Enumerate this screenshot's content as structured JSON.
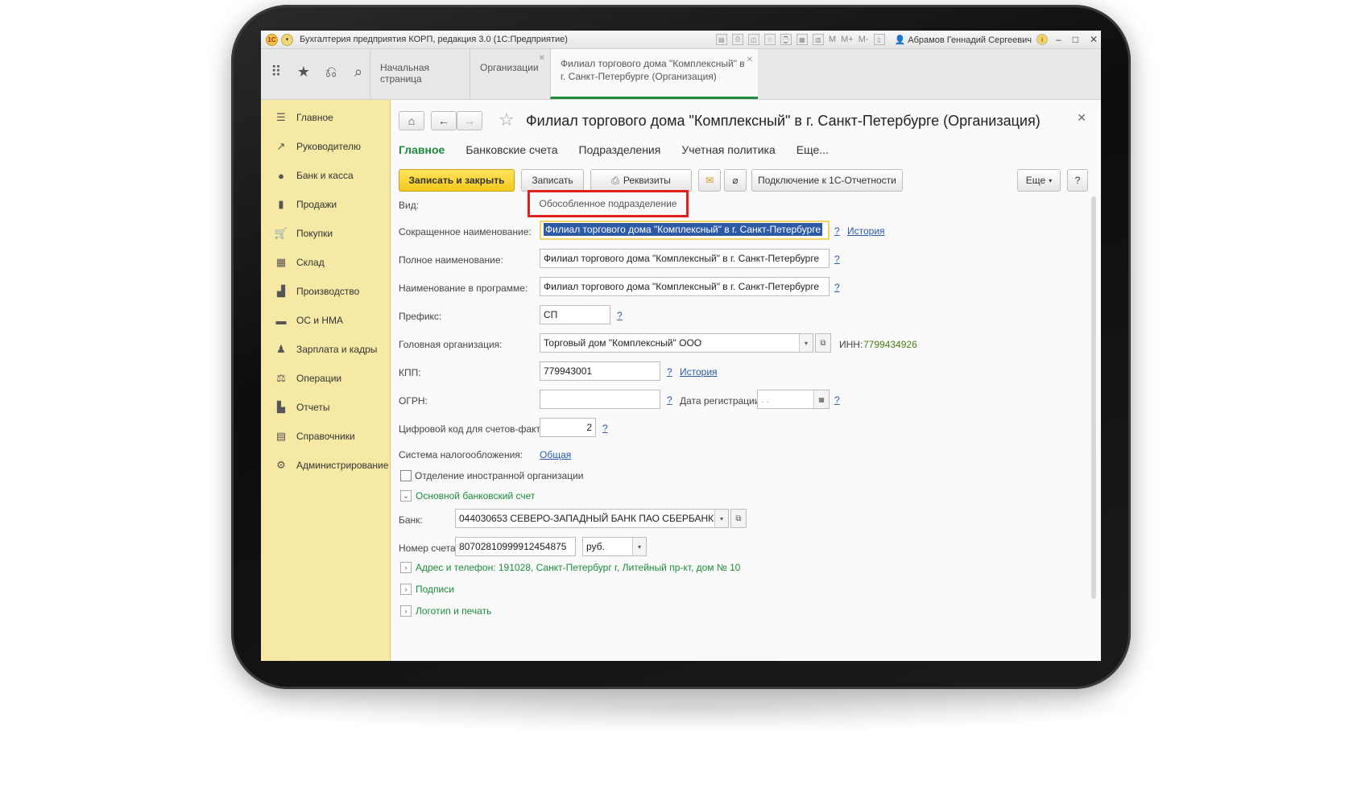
{
  "window": {
    "title": "Бухгалтерия предприятия КОРП, редакция 3.0 (1С:Предприятие)",
    "user": "Абрамов Геннадий Сергеевич",
    "tool_m": "M",
    "tool_mplus": "M+",
    "tool_mminus": "M-"
  },
  "tabs": [
    {
      "label": "Начальная страница"
    },
    {
      "label": "Организации"
    },
    {
      "label": "Филиал торгового дома \"Комплексный\" в г. Санкт-Петербурге (Организация)"
    }
  ],
  "sidebar": {
    "items": [
      {
        "label": "Главное",
        "icon": "menu-icon"
      },
      {
        "label": "Руководителю",
        "icon": "chart-line-icon"
      },
      {
        "label": "Банк и касса",
        "icon": "bank-icon"
      },
      {
        "label": "Продажи",
        "icon": "bag-icon"
      },
      {
        "label": "Покупки",
        "icon": "cart-icon"
      },
      {
        "label": "Склад",
        "icon": "warehouse-icon"
      },
      {
        "label": "Производство",
        "icon": "factory-icon"
      },
      {
        "label": "ОС и НМА",
        "icon": "truck-icon"
      },
      {
        "label": "Зарплата и кадры",
        "icon": "person-icon"
      },
      {
        "label": "Операции",
        "icon": "operations-icon"
      },
      {
        "label": "Отчеты",
        "icon": "bar-chart-icon"
      },
      {
        "label": "Справочники",
        "icon": "book-icon"
      },
      {
        "label": "Администрирование",
        "icon": "gear-icon"
      }
    ]
  },
  "form": {
    "title": "Филиал торгового дома \"Комплексный\" в г. Санкт-Петербурге (Организация)",
    "subtabs": [
      "Главное",
      "Банковские счета",
      "Подразделения",
      "Учетная политика",
      "Еще..."
    ],
    "buttons": {
      "save_close": "Записать и закрыть",
      "save": "Записать",
      "requisites": "Реквизиты",
      "connect": "Подключение к 1С-Отчетности",
      "more": "Еще",
      "help": "?"
    },
    "fields": {
      "vid_label": "Вид:",
      "vid_value": "Обособленное подразделение",
      "short_name_label": "Сокращенное наименование:",
      "short_name_value": "Филиал торгового дома \"Комплексный\" в г. Санкт-Петербурге",
      "full_name_label": "Полное наименование:",
      "full_name_value": "Филиал торгового дома \"Комплексный\" в г. Санкт-Петербурге",
      "program_name_label": "Наименование в программе:",
      "program_name_value": "Филиал торгового дома \"Комплексный\" в г. Санкт-Петербурге",
      "prefix_label": "Префикс:",
      "prefix_value": "СП",
      "head_org_label": "Головная организация:",
      "head_org_value": "Торговый дом \"Комплексный\" ООО",
      "inn_label": "ИНН:",
      "inn_value": "7799434926",
      "kpp_label": "КПП:",
      "kpp_value": "779943001",
      "ogrn_label": "ОГРН:",
      "ogrn_value": "",
      "reg_date_label": "Дата регистрации:",
      "reg_date_value": " .  .",
      "invoice_code_label": "Цифровой код для счетов-фактур:",
      "invoice_code_value": "2",
      "tax_system_label": "Система налогообложения:",
      "tax_system_value": "Общая",
      "foreign_org_label": "Отделение иностранной организации",
      "history": "История",
      "q": "?"
    },
    "bank_group": {
      "title": "Основной банковский счет",
      "bank_label": "Банк:",
      "bank_value": "044030653 СЕВЕРО-ЗАПАДНЫЙ БАНК ПАО СБЕРБАНК",
      "account_label": "Номер счета:",
      "account_value": "80702810999912454875",
      "currency_value": "руб."
    },
    "groups": [
      "Адрес и телефон: 191028, Санкт-Петербург г, Литейный пр-кт, дом № 10",
      "Подписи",
      "Логотип и печать"
    ]
  }
}
